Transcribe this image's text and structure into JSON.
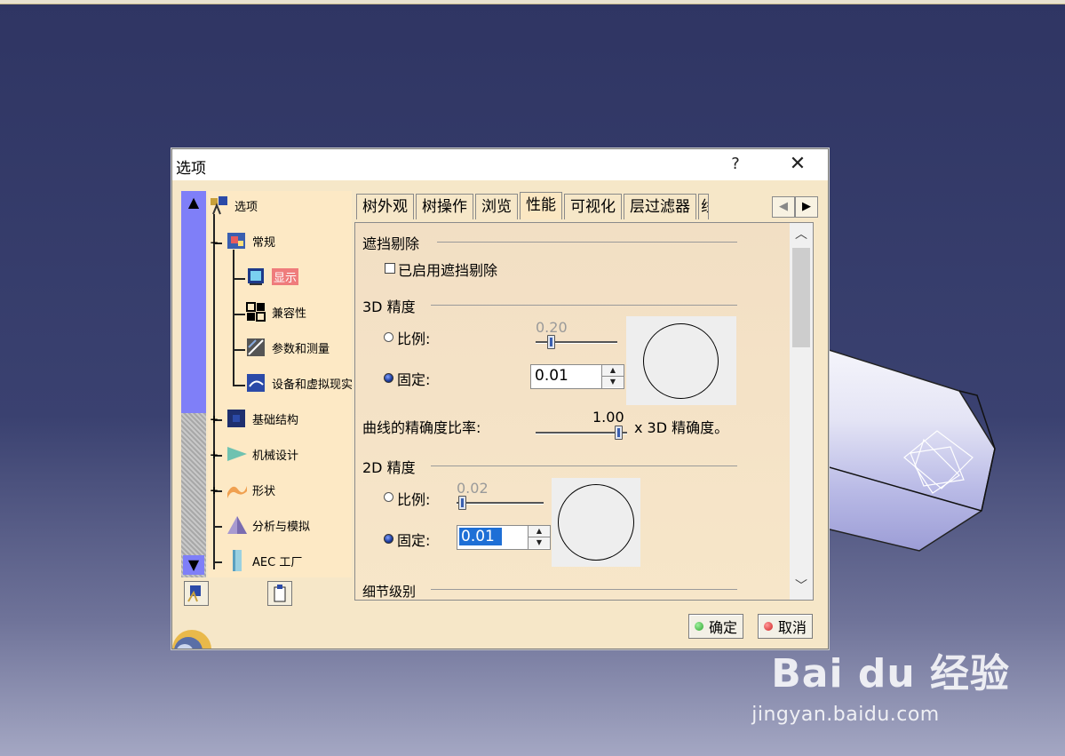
{
  "dialog": {
    "title": "选项",
    "help_label": "?",
    "close_label": "✕"
  },
  "tree": {
    "items": [
      {
        "label": "选项",
        "icon": "options-root-icon"
      },
      {
        "label": "常规",
        "icon": "general-icon",
        "expander": "−"
      },
      {
        "label": "显示",
        "icon": "display-icon",
        "selected": true
      },
      {
        "label": "兼容性",
        "icon": "compatibility-icon"
      },
      {
        "label": "参数和测量",
        "icon": "parameters-measure-icon"
      },
      {
        "label": "设备和虚拟现实",
        "icon": "devices-vr-icon"
      },
      {
        "label": "基础结构",
        "icon": "infrastructure-icon",
        "expander": "+"
      },
      {
        "label": "机械设计",
        "icon": "mechanical-design-icon",
        "expander": "+"
      },
      {
        "label": "形状",
        "icon": "shape-icon",
        "expander": "+"
      },
      {
        "label": "分析与模拟",
        "icon": "analysis-simulation-icon"
      },
      {
        "label": "AEC 工厂",
        "icon": "aec-plant-icon"
      }
    ],
    "scroll_up": "▲",
    "scroll_down": "▼"
  },
  "tabs": [
    {
      "label": "树外观",
      "active": false
    },
    {
      "label": "树操作",
      "active": false
    },
    {
      "label": "浏览",
      "active": false
    },
    {
      "label": "性能",
      "active": true
    },
    {
      "label": "可视化",
      "active": false
    },
    {
      "label": "层过滤器",
      "active": false
    },
    {
      "label": "线",
      "active": false
    }
  ],
  "tab_arrows": {
    "left": "◀",
    "right": "▶"
  },
  "performance": {
    "occlusion": {
      "section_title": "遮挡剔除",
      "checkbox_label": "已启用遮挡剔除",
      "checked": false
    },
    "precision_3d": {
      "section_title": "3D 精度",
      "ratio_label": "比例:",
      "ratio_value": "0.20",
      "ratio_selected": false,
      "fixed_label": "固定:",
      "fixed_value": "0.01",
      "fixed_selected": true,
      "curve_label": "曲线的精确度比率:",
      "curve_value": "1.00",
      "curve_suffix": "x 3D 精确度。"
    },
    "precision_2d": {
      "section_title": "2D 精度",
      "ratio_label": "比例:",
      "ratio_value": "0.02",
      "ratio_selected": false,
      "fixed_label": "固定:",
      "fixed_value": "0.01",
      "fixed_selected": true
    },
    "lod": {
      "section_title": "细节级别"
    }
  },
  "footer": {
    "ok_label": "确定",
    "cancel_label": "取消",
    "ok_color": "#2ea52e",
    "cancel_color": "#d02020"
  },
  "watermark": {
    "logo_text": "Bai du 经验",
    "url": "jingyan.baidu.com"
  },
  "colors": {
    "dialog_bg": "#f6e7c8",
    "tree_bg": "#fde9c5",
    "selection": "#ef7c7c",
    "scroll_accent": "#7f7ff8"
  }
}
